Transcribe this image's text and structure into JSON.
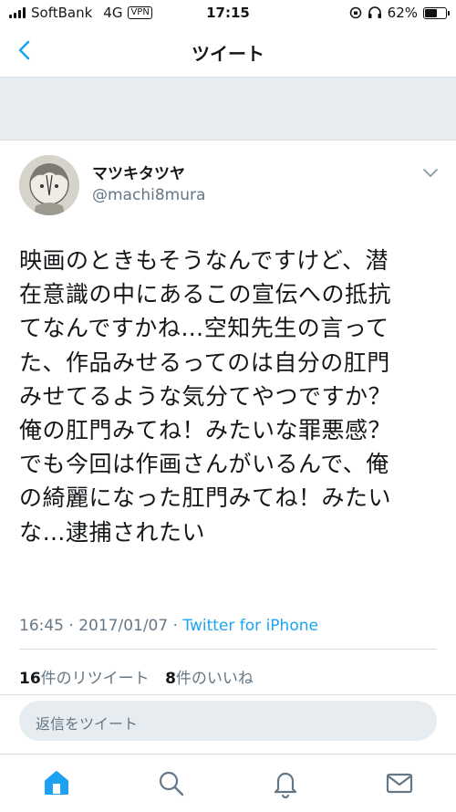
{
  "status": {
    "carrier": "SoftBank",
    "network": "4G",
    "vpn": "VPN",
    "time": "17:15",
    "battery": "62%",
    "battery_level": 0.62
  },
  "nav": {
    "title": "ツイート",
    "back_icon": "chevron-left-icon"
  },
  "tweet": {
    "name": "マツキタツヤ",
    "handle": "@machi8mura",
    "text": "映画のときもそうなんですけど、潜\n在意識の中にあるこの宣伝への抵抗\nてなんですかね…空知先生の言って\nた、作品みせるってのは自分の肛門\nみせてるような気分てやつですか？\n俺の肛門みてね！みたいな罪悪感？\nでも今回は作画さんがいるんで、俺\nの綺麗になった肛門みてね！みたい\nな…逮捕されたい",
    "timestamp": "16:45 · 2017/01/07 · ",
    "source": "Twitter for iPhone",
    "retweet_count": "16",
    "retweet_label": "件のリツイート",
    "like_count": "8",
    "like_label": "件のいいね"
  },
  "reply": {
    "placeholder": "返信をツイート"
  },
  "tabs": [
    {
      "icon": "home-icon",
      "active": true
    },
    {
      "icon": "search-icon",
      "active": false
    },
    {
      "icon": "bell-icon",
      "active": false
    },
    {
      "icon": "mail-icon",
      "active": false
    }
  ],
  "colors": {
    "accent": "#1da1f2",
    "text": "#14171a",
    "muted": "#657786",
    "banner": "#e6ecf0",
    "divider": "#d8dde2"
  }
}
